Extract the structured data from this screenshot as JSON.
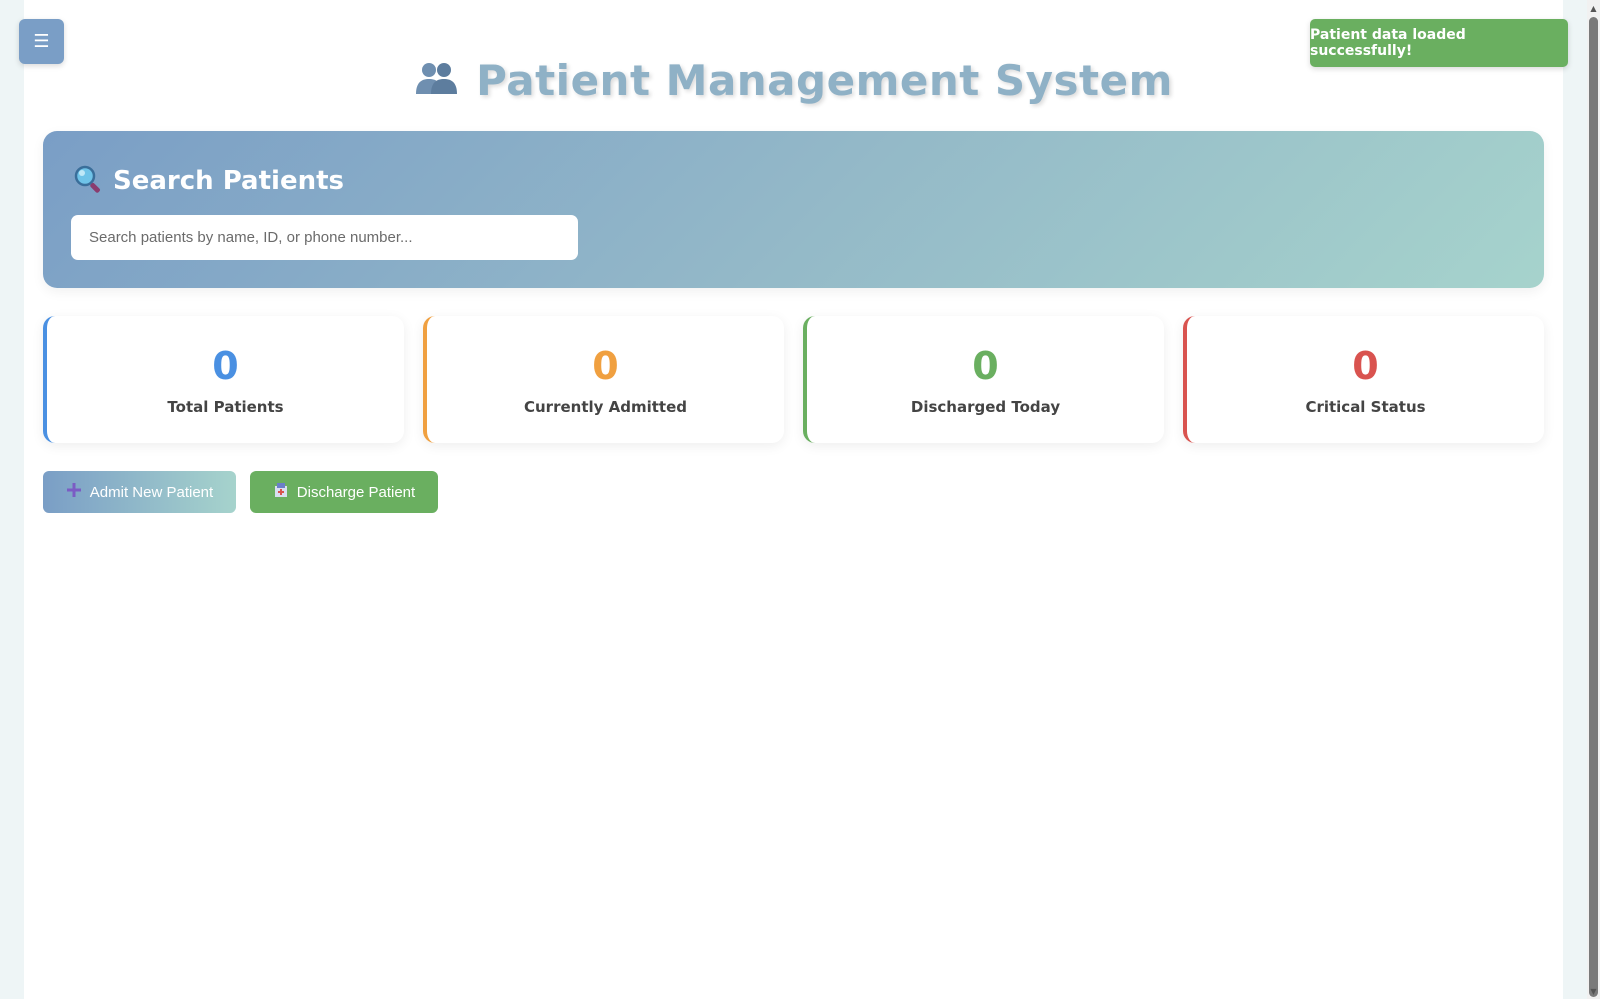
{
  "header": {
    "menu_icon": "☰",
    "title": "Patient Management System",
    "title_icon": "users-icon"
  },
  "toast": {
    "message": "Patient data loaded successfully!",
    "color": "#6aaf60"
  },
  "search": {
    "heading": "Search Patients",
    "heading_icon": "magnifier-icon",
    "placeholder": "Search patients by name, ID, or phone number...",
    "value": ""
  },
  "stats": [
    {
      "value": "0",
      "label": "Total Patients",
      "color": "#4a90e2"
    },
    {
      "value": "0",
      "label": "Currently Admitted",
      "color": "#f0a040"
    },
    {
      "value": "0",
      "label": "Discharged Today",
      "color": "#6aaf60"
    },
    {
      "value": "0",
      "label": "Critical Status",
      "color": "#d9534f"
    }
  ],
  "actions": {
    "admit_label": "Admit New Patient",
    "admit_icon": "plus-icon",
    "discharge_label": "Discharge Patient",
    "discharge_icon": "hospital-icon"
  },
  "colors": {
    "accent": "#7a9ec6",
    "accent_light": "#a6d3cc",
    "success": "#6aaf60"
  }
}
